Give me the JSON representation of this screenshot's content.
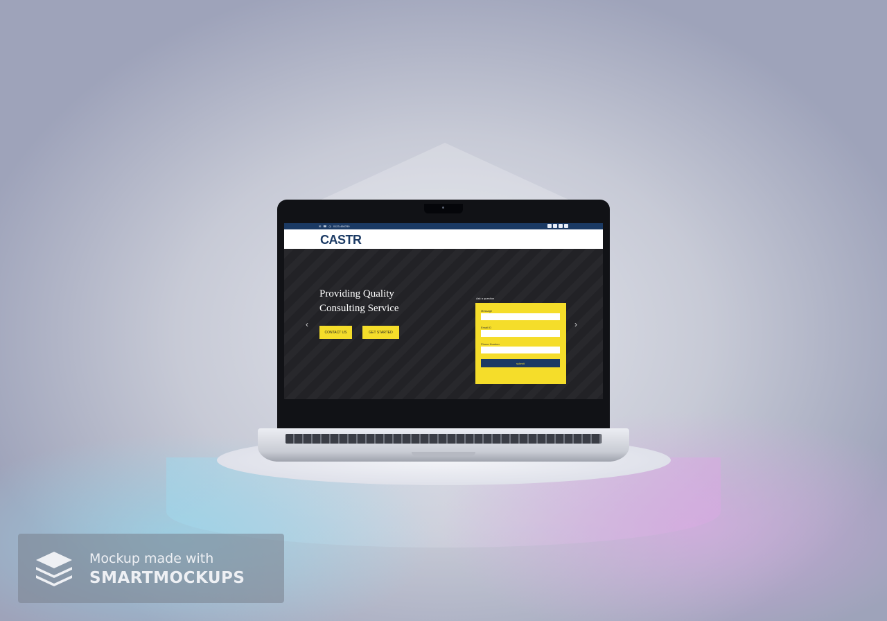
{
  "website": {
    "topbar": {
      "phone": "0123-456789"
    },
    "logo": "CASTR",
    "hero": {
      "headline_line1": "Providing Quality",
      "headline_line2": "Consulting Service",
      "contact_button": "CONTACT US",
      "started_button": "GET STARTED"
    },
    "form": {
      "heading": "Ask a question",
      "message_label": "Message",
      "email_label": "Email ID",
      "phone_label": "Phone Number",
      "submit_label": "submit"
    },
    "colors": {
      "brand_navy": "#1b3a64",
      "accent_yellow": "#f5dd2a"
    }
  },
  "watermark": {
    "line1": "Mockup made with",
    "line2": "SMARTMOCKUPS",
    "icon": "layers-stack-icon"
  }
}
